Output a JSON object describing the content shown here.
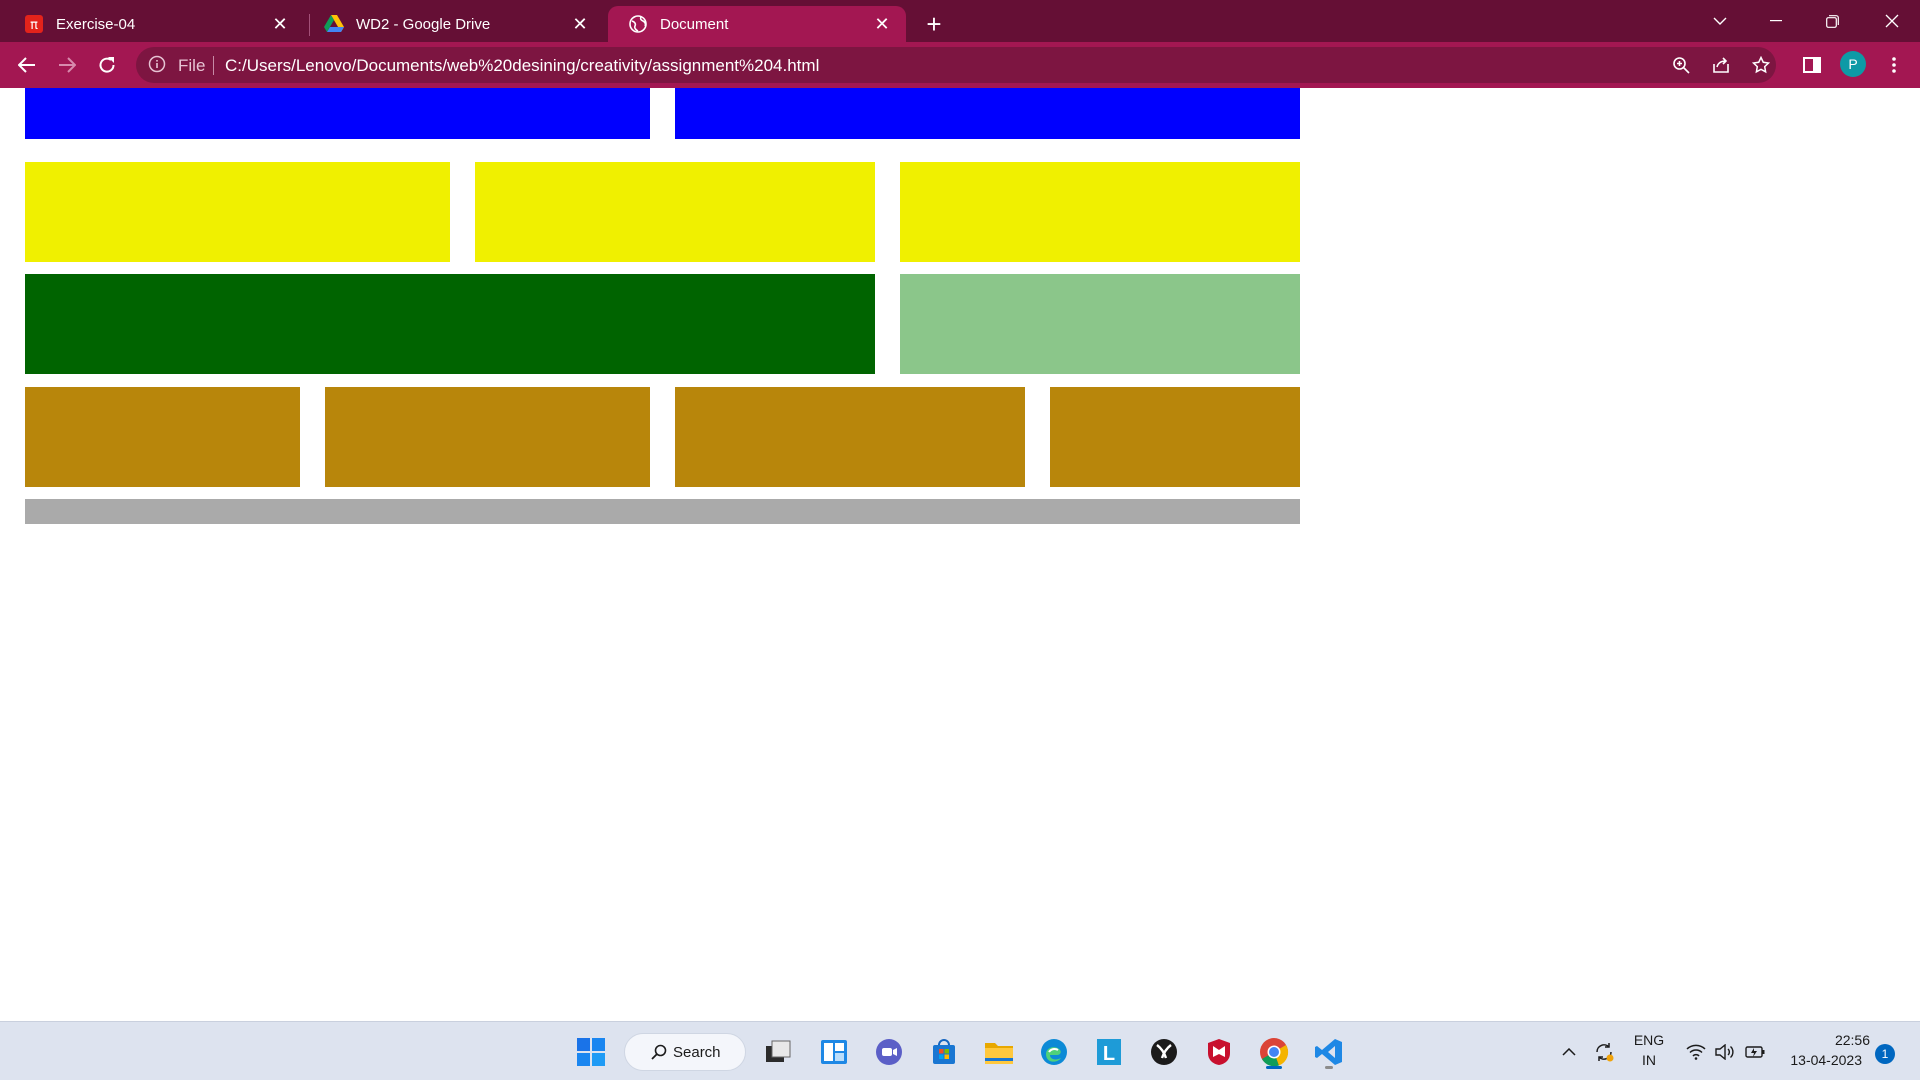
{
  "tabs": [
    {
      "title": "Exercise-04",
      "icon": "exercise-app-icon"
    },
    {
      "title": "WD2 - Google Drive",
      "icon": "google-drive-icon"
    },
    {
      "title": "Document",
      "icon": "globe-icon",
      "active": true
    }
  ],
  "address_bar": {
    "scheme_label": "File",
    "url": "C:/Users/Lenovo/Documents/web%20desining/creativity/assignment%204.html"
  },
  "profile": {
    "initial": "P"
  },
  "colors": {
    "chrome_frame": "#650f35",
    "chrome_toolbar": "#a31752",
    "blue": "#0000ff",
    "yellow": "#f0f000",
    "dark_green": "#006400",
    "light_green": "#8bc68a",
    "dark_goldenrod": "#b8860b",
    "gray": "#aaaaaa"
  },
  "page": {
    "rows": [
      {
        "name": "blue-row",
        "blocks": [
          "blue",
          "blue"
        ]
      },
      {
        "name": "yellow-row",
        "blocks": [
          "yellow",
          "yellow",
          "yellow"
        ]
      },
      {
        "name": "green-row",
        "blocks": [
          "dark_green",
          "light_green"
        ]
      },
      {
        "name": "gold-row",
        "blocks": [
          "dark_goldenrod",
          "dark_goldenrod",
          "dark_goldenrod",
          "dark_goldenrod"
        ]
      },
      {
        "name": "gray-row",
        "blocks": [
          "gray"
        ]
      }
    ]
  },
  "taskbar": {
    "search_label": "Search",
    "apps": [
      "start-icon",
      "search-icon",
      "task-view-icon",
      "widgets-icon",
      "teams-chat-icon",
      "microsoft-store-icon",
      "file-explorer-icon",
      "edge-icon",
      "l-app-icon",
      "xbox-icon",
      "mcafee-icon",
      "chrome-icon",
      "vscode-icon"
    ]
  },
  "tray": {
    "language": "ENG",
    "region": "IN",
    "time": "22:56",
    "date": "13-04-2023",
    "notifications": "1"
  }
}
